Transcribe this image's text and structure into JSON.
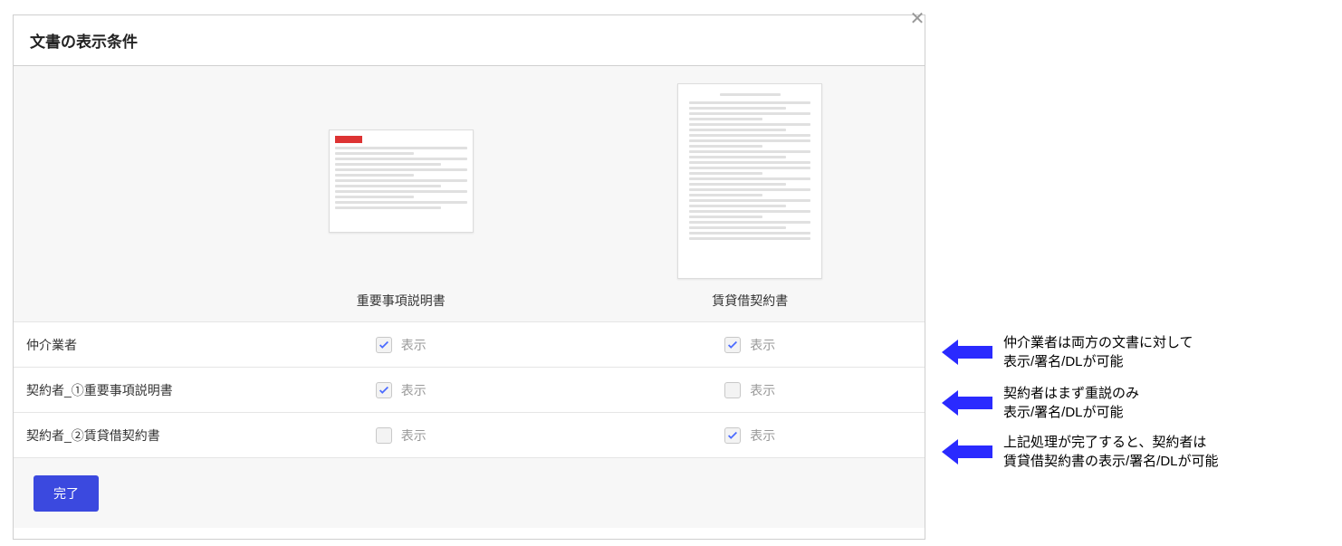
{
  "modal": {
    "title": "文書の表示条件",
    "close_glyph": "✕"
  },
  "docs": [
    {
      "name": "重要事項説明書"
    },
    {
      "name": "賃貸借契約書"
    }
  ],
  "rows": [
    {
      "label": "仲介業者",
      "cells": [
        {
          "checked": true,
          "label": "表示"
        },
        {
          "checked": true,
          "label": "表示"
        }
      ]
    },
    {
      "label": "契約者_①重要事項説明書",
      "cells": [
        {
          "checked": true,
          "label": "表示"
        },
        {
          "checked": false,
          "label": "表示"
        }
      ]
    },
    {
      "label": "契約者_②賃貸借契約書",
      "cells": [
        {
          "checked": false,
          "label": "表示"
        },
        {
          "checked": true,
          "label": "表示"
        }
      ]
    }
  ],
  "footer": {
    "done_label": "完了"
  },
  "annotations": [
    {
      "text": "仲介業者は両方の文書に対して\n表示/署名/DLが可能"
    },
    {
      "text": "契約者はまず重説のみ\n表示/署名/DLが可能"
    },
    {
      "text": "上記処理が完了すると、契約者は\n賃貸借契約書の表示/署名/DLが可能"
    }
  ]
}
